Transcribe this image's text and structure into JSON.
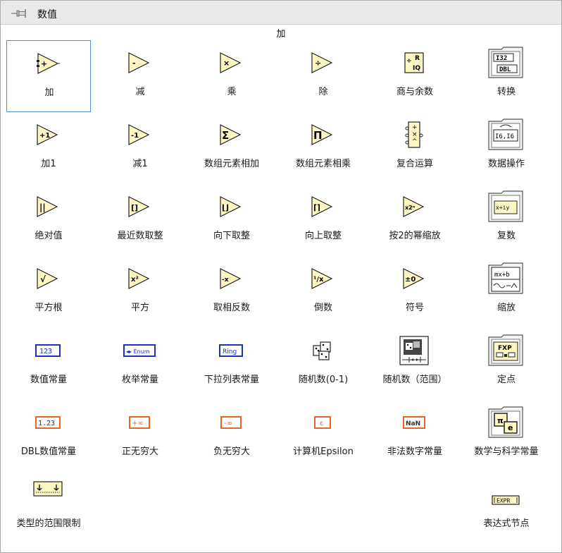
{
  "window": {
    "title": "数值",
    "hover_label": "加"
  },
  "items": [
    {
      "label": "加",
      "glyph": "+"
    },
    {
      "label": "减",
      "glyph": "-"
    },
    {
      "label": "乘",
      "glyph": "×"
    },
    {
      "label": "除",
      "glyph": "÷"
    },
    {
      "label": "商与余数",
      "glyph": "÷R IQ"
    },
    {
      "label": "转换",
      "glyph_top": "I32",
      "glyph_bottom": "DBL"
    },
    {
      "label": "加1",
      "glyph": "+1"
    },
    {
      "label": "减1",
      "glyph": "-1"
    },
    {
      "label": "数组元素相加",
      "glyph": "Σ"
    },
    {
      "label": "数组元素相乘",
      "glyph": "Π"
    },
    {
      "label": "复合运算",
      "glyph": "+×^"
    },
    {
      "label": "数据操作",
      "glyph": "I6,I6"
    },
    {
      "label": "绝对值",
      "glyph": "||"
    },
    {
      "label": "最近数取整",
      "glyph": "[]"
    },
    {
      "label": "向下取整",
      "glyph": "⌊⌋"
    },
    {
      "label": "向上取整",
      "glyph": "⌈⌉"
    },
    {
      "label": "按2的幂缩放",
      "glyph": "x2ⁿ"
    },
    {
      "label": "复数",
      "glyph": "x+iy"
    },
    {
      "label": "平方根",
      "glyph": "√"
    },
    {
      "label": "平方",
      "glyph": "x²"
    },
    {
      "label": "取相反数",
      "glyph": "-x"
    },
    {
      "label": "倒数",
      "glyph": "¹/x"
    },
    {
      "label": "符号",
      "glyph": "±0"
    },
    {
      "label": "缩放",
      "glyph": "mx+b"
    },
    {
      "label": "数值常量",
      "glyph": "123"
    },
    {
      "label": "枚举常量",
      "glyph": "◂▸ Enum"
    },
    {
      "label": "下拉列表常量",
      "glyph": "Ring"
    },
    {
      "label": "随机数(0-1)",
      "glyph": "dice"
    },
    {
      "label": "随机数（范围）",
      "glyph": "dice"
    },
    {
      "label": "定点",
      "glyph": "FXP"
    },
    {
      "label": "DBL数值常量",
      "glyph": "1.23"
    },
    {
      "label": "正无穷大",
      "glyph": "+∞"
    },
    {
      "label": "负无穷大",
      "glyph": "-∞"
    },
    {
      "label": "计算机Epsilon",
      "glyph": "ε"
    },
    {
      "label": "非法数字常量",
      "glyph": "NaN"
    },
    {
      "label": "数学与科学常量",
      "glyph_top": "π",
      "glyph_bottom": "e"
    },
    {
      "label": "类型的范围限制",
      "glyph": "range"
    },
    {
      "label": "表达式节点",
      "glyph": "EXPR"
    }
  ]
}
